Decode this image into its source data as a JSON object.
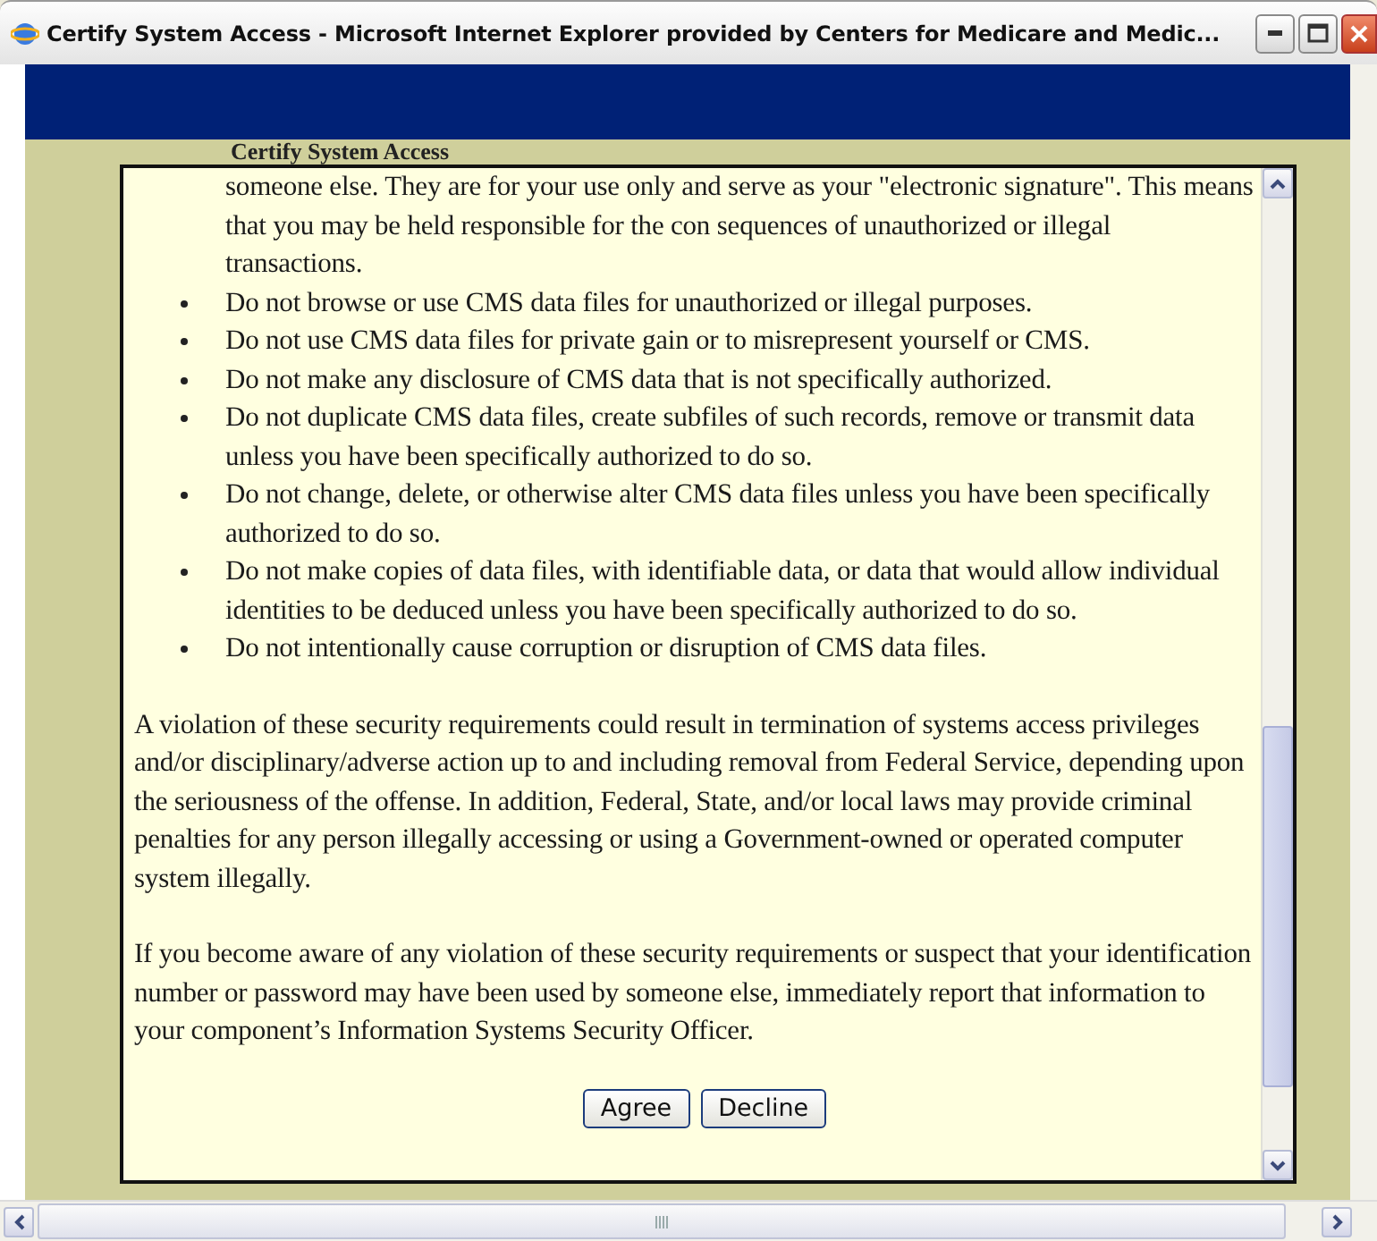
{
  "window": {
    "title": "Certify System Access - Microsoft Internet Explorer provided by Centers for Medicare and Medic..."
  },
  "page": {
    "heading": "Certify System Access"
  },
  "rules": [
    {
      "kind": "continuation",
      "text": "someone else. They are for your use only and serve as your \"electronic signature\". This means that you may be held responsible for the con sequences of unauthorized or illegal transactions."
    },
    {
      "kind": "bullet",
      "text": "Do not browse or use CMS data files for unauthorized or illegal purposes."
    },
    {
      "kind": "bullet",
      "text": "Do not use CMS data files for private gain or to misrepresent yourself or CMS."
    },
    {
      "kind": "bullet",
      "text": "Do not make any disclosure of CMS data that is not specifically authorized."
    },
    {
      "kind": "bullet",
      "text": "Do not duplicate CMS data files, create subfiles of such records, remove or transmit data unless you have been specifically authorized to do so."
    },
    {
      "kind": "bullet",
      "text": "Do not change, delete, or otherwise alter CMS data files unless you have been specifically authorized to do so."
    },
    {
      "kind": "bullet",
      "text": "Do not make copies of data files, with identifiable data, or data that would allow individual identities to be deduced unless you have been specifically authorized to do so."
    },
    {
      "kind": "bullet",
      "text": "Do not intentionally cause corruption or disruption of CMS data files."
    }
  ],
  "paragraphs": [
    "A violation of these security requirements could result in termination of systems access privileges and/or disciplinary/adverse action up to and including removal from Federal Service, depending upon the seriousness of the offense. In addition, Federal, State, and/or local laws may provide criminal penalties for any person illegally accessing or using a Government-owned or operated computer system illegally.",
    "If you become aware of any violation of these security requirements or suspect that your identification number or password may have been used by someone else, immediately report that information to your component’s Information Systems Security Officer."
  ],
  "buttons": [
    "Agree",
    "Decline"
  ]
}
